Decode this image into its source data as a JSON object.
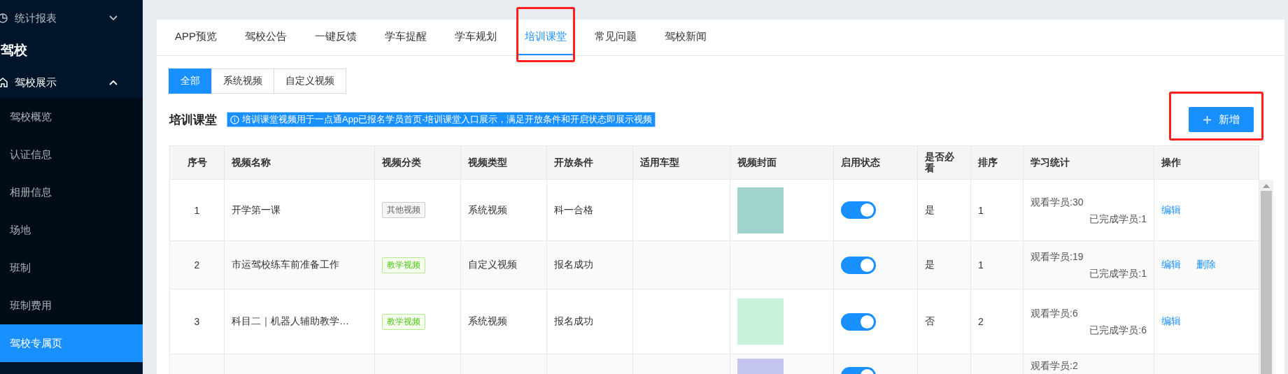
{
  "sidebar": {
    "items": [
      {
        "kind": "menu",
        "label": "统计报表",
        "expanded": false
      },
      {
        "kind": "section",
        "label": "驾校"
      },
      {
        "kind": "menu",
        "label": "驾校展示",
        "expanded": true,
        "children": [
          {
            "label": "驾校概览",
            "selected": false
          },
          {
            "label": "认证信息",
            "selected": false
          },
          {
            "label": "相册信息",
            "selected": false
          },
          {
            "label": "场地",
            "selected": false
          },
          {
            "label": "班制",
            "selected": false
          },
          {
            "label": "班制费用",
            "selected": false
          },
          {
            "label": "驾校专属页",
            "selected": true
          }
        ]
      }
    ]
  },
  "tabs": [
    {
      "label": "APP预览",
      "selected": false,
      "highlighted": false
    },
    {
      "label": "驾校公告",
      "selected": false,
      "highlighted": false
    },
    {
      "label": "一键反馈",
      "selected": false,
      "highlighted": false
    },
    {
      "label": "学车提醒",
      "selected": false,
      "highlighted": false
    },
    {
      "label": "学车规划",
      "selected": false,
      "highlighted": false
    },
    {
      "label": "培训课堂",
      "selected": true,
      "highlighted": true
    },
    {
      "label": "常见问题",
      "selected": false,
      "highlighted": false
    },
    {
      "label": "驾校新闻",
      "selected": false,
      "highlighted": false
    }
  ],
  "filters": [
    {
      "label": "全部",
      "selected": true
    },
    {
      "label": "系统视频",
      "selected": false
    },
    {
      "label": "自定义视频",
      "selected": false
    }
  ],
  "section": {
    "title": "培训课堂",
    "notice": "培训课堂视频用于一点通App已报名学员首页-培训课堂入口展示，满足开放条件和开启状态即展示视频",
    "notice_selected": true,
    "add_button": {
      "label": "新增",
      "highlighted": true
    }
  },
  "table": {
    "columns": [
      "序号",
      "视频名称",
      "视频分类",
      "视频类型",
      "开放条件",
      "适用车型",
      "视频封面",
      "启用状态",
      "是否必看",
      "排序",
      "学习统计",
      "操作"
    ],
    "rows": [
      {
        "no": "1",
        "name": "开学第一课",
        "category": {
          "label": "其他视频",
          "kind": "other"
        },
        "type": "系统视频",
        "condition": "科一合格",
        "cover": true,
        "enabled": true,
        "required": "是",
        "order": "1",
        "watched": "观看学员:30",
        "finished": "已完成学员:1",
        "actions": [
          "编辑"
        ]
      },
      {
        "no": "2",
        "name": "市运驾校练车前准备工作",
        "category": {
          "label": "教学视频",
          "kind": "teaching"
        },
        "type": "自定义视频",
        "condition": "报名成功",
        "cover": false,
        "enabled": true,
        "required": "是",
        "order": "1",
        "watched": "观看学员:19",
        "finished": "已完成学员:1",
        "actions": [
          "编辑",
          "删除"
        ]
      },
      {
        "no": "3",
        "name": "科目二｜机器人辅助教学…",
        "category": {
          "label": "教学视频",
          "kind": "teaching"
        },
        "type": "系统视频",
        "condition": "报名成功",
        "cover": true,
        "enabled": true,
        "required": "否",
        "order": "2",
        "watched": "观看学员:6",
        "finished": "已完成学员:6",
        "actions": [
          "编辑"
        ]
      },
      {
        "cover": true,
        "enabled": true,
        "watched": "观看学员:2"
      }
    ]
  }
}
